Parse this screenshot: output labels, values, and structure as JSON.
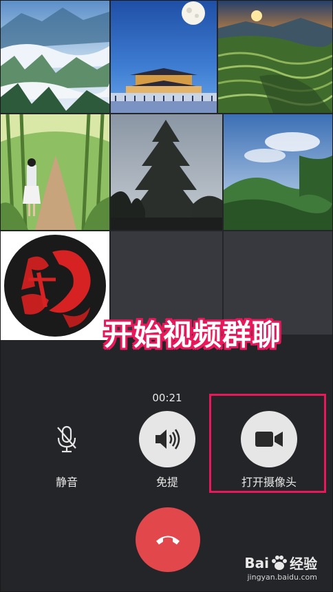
{
  "caption": "开始视频群聊",
  "call": {
    "timer": "00:21"
  },
  "controls": {
    "mute_label": "静音",
    "speaker_label": "免提",
    "camera_label": "打开摄像头",
    "hangup_icon": "phone-hangup-icon"
  },
  "participants": [
    {
      "icon": "mountain-clouds-photo"
    },
    {
      "icon": "temple-moon-photo"
    },
    {
      "icon": "terraced-hills-sunset-photo"
    },
    {
      "icon": "bamboo-path-girl-photo"
    },
    {
      "icon": "pine-tree-photo"
    },
    {
      "icon": "forest-sky-photo"
    },
    {
      "icon": "dragon-avatar"
    }
  ],
  "watermark": {
    "brand": "Bai",
    "brand2": "经验",
    "url": "jingyan.baidu.com"
  },
  "colors": {
    "background": "#242529",
    "highlight": "#e8185a",
    "hangup": "#e2474b",
    "button": "#e6e6e6"
  }
}
